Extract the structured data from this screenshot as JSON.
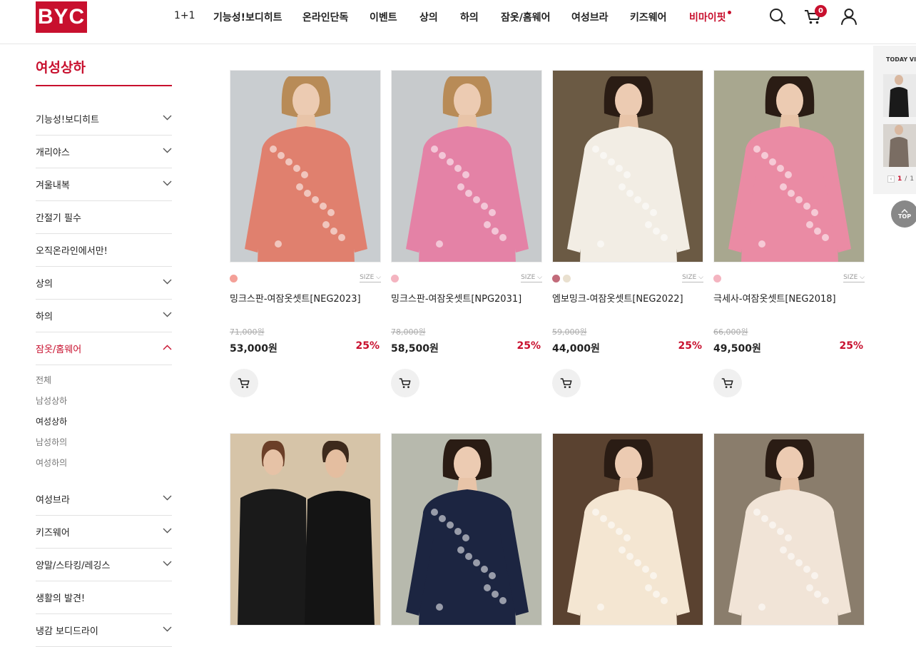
{
  "header": {
    "logo": "BYC",
    "nav": [
      {
        "label": "1+1",
        "style": "plain"
      },
      {
        "label": "기능성!보디히트",
        "style": "bold"
      },
      {
        "label": "온라인단독",
        "style": "bold"
      },
      {
        "label": "이벤트",
        "style": "bold"
      },
      {
        "label": "상의",
        "style": "bold"
      },
      {
        "label": "하의",
        "style": "bold"
      },
      {
        "label": "잠옷/홈웨어",
        "style": "bold"
      },
      {
        "label": "여성브라",
        "style": "bold"
      },
      {
        "label": "키즈웨어",
        "style": "bold"
      },
      {
        "label": "비마이핏",
        "style": "red"
      }
    ],
    "cart_count": "0",
    "icons": [
      "search-icon",
      "cart-icon",
      "user-icon"
    ]
  },
  "sidebar": {
    "title": "여성상하",
    "items": [
      {
        "label": "기능성!보디히트",
        "chevron": "down"
      },
      {
        "label": "개리야스",
        "chevron": "down"
      },
      {
        "label": "겨울내복",
        "chevron": "down"
      },
      {
        "label": "간절기 필수",
        "chevron": "none"
      },
      {
        "label": "오직온라인에서만!",
        "chevron": "none"
      },
      {
        "label": "상의",
        "chevron": "down"
      },
      {
        "label": "하의",
        "chevron": "down"
      },
      {
        "label": "잠옷/홈웨어",
        "chevron": "up",
        "active": true
      }
    ],
    "sub_items": [
      {
        "label": "전체"
      },
      {
        "label": "남성상하"
      },
      {
        "label": "여성상하",
        "active": true
      },
      {
        "label": "남성하의"
      },
      {
        "label": "여성하의"
      }
    ],
    "items_after": [
      {
        "label": "여성브라",
        "chevron": "down"
      },
      {
        "label": "키즈웨어",
        "chevron": "down"
      },
      {
        "label": "양말/스타킹/레깅스",
        "chevron": "down"
      },
      {
        "label": "생활의 발견!",
        "chevron": "none"
      },
      {
        "label": "냉감 보디드라이",
        "chevron": "down"
      }
    ]
  },
  "products": [
    {
      "name": "밍크스판-여잠옷셋트[NEG2023]",
      "orig_price": "71,000원",
      "price": "53,000원",
      "discount": "25%",
      "size_label": "SIZE",
      "swatches": [
        "#f4a098"
      ],
      "bg": "#c9cdd0",
      "garment": "#e0806e"
    },
    {
      "name": "밍크스판-여잠옷셋트[NPG2031]",
      "orig_price": "78,000원",
      "price": "58,500원",
      "discount": "25%",
      "size_label": "SIZE",
      "swatches": [
        "#f4b4c0"
      ],
      "bg": "#c7cacc",
      "garment": "#e482a6"
    },
    {
      "name": "엠보밍크-여잠옷셋트[NEG2022]",
      "orig_price": "59,000원",
      "price": "44,000원",
      "discount": "25%",
      "size_label": "SIZE",
      "swatches": [
        "#c26b7a",
        "#e9e0cf"
      ],
      "bg": "#6b5a44",
      "garment": "#f2ede4"
    },
    {
      "name": "극세사-여잠옷셋트[NEG2018]",
      "orig_price": "66,000원",
      "price": "49,500원",
      "discount": "25%",
      "size_label": "SIZE",
      "swatches": [
        "#f4b4c0"
      ],
      "bg": "#a8a78f",
      "garment": "#ea8ba4"
    },
    {
      "name": "",
      "bg": "#d6c4a8",
      "garment": "#1a1a1a"
    },
    {
      "name": "",
      "bg": "#b7b9ad",
      "garment": "#1c2541"
    },
    {
      "name": "",
      "bg": "#5a4230",
      "garment": "#f4e6d2"
    },
    {
      "name": "",
      "bg": "#8a7d6c",
      "garment": "#f1e4d7"
    }
  ],
  "today_viewed": {
    "title": "TODAY VIEW",
    "page_current": "1",
    "page_sep": "/",
    "page_total": "1"
  },
  "top_button": "TOP"
}
